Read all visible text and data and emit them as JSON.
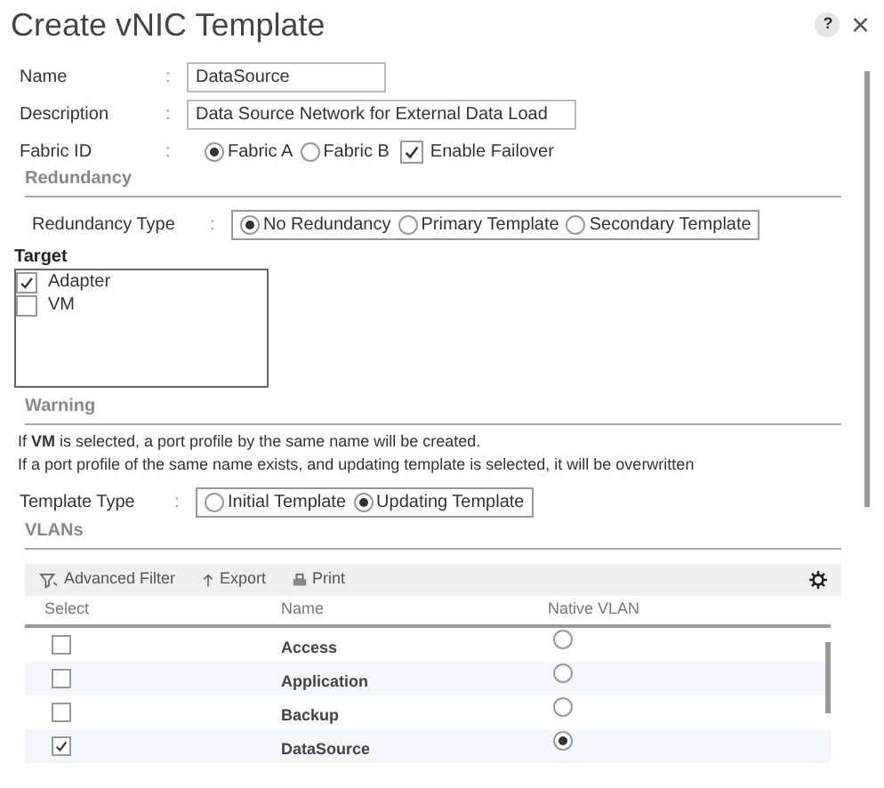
{
  "dialog": {
    "title": "Create vNIC Template",
    "help": "?",
    "close": "×"
  },
  "name": {
    "label": "Name",
    "separator": ":",
    "value": "DataSource"
  },
  "description": {
    "label": "Description",
    "separator": ":",
    "value": "Data Source Network for External Data Load"
  },
  "fabric_id": {
    "label": "Fabric ID",
    "separator": ":",
    "options": [
      {
        "label": "Fabric A",
        "selected": true
      },
      {
        "label": "Fabric B",
        "selected": false
      }
    ],
    "failover": {
      "label": "Enable Failover",
      "checked": true
    }
  },
  "redundancy": {
    "heading": "Redundancy",
    "label": "Redundancy Type",
    "separator": ":",
    "options": [
      {
        "label": "No Redundancy",
        "selected": true
      },
      {
        "label": "Primary Template",
        "selected": false
      },
      {
        "label": "Secondary Template",
        "selected": false
      }
    ]
  },
  "target": {
    "label": "Target",
    "items": [
      {
        "label": "Adapter",
        "checked": true
      },
      {
        "label": "VM",
        "checked": false
      }
    ]
  },
  "warning": {
    "heading": "Warning",
    "lines": [
      "If **VM** is selected, a port profile by the same name will be created.",
      "If a port profile of the same name exists, and updating template is selected, it will be overwritten"
    ]
  },
  "template_type": {
    "label": "Template Type",
    "separator": ":",
    "options": [
      {
        "label": "Initial Template",
        "selected": false
      },
      {
        "label": "Updating Template",
        "selected": true
      }
    ]
  },
  "vlans": {
    "heading": "VLANs",
    "toolbar": [
      "Advanced Filter",
      "Export",
      "Print"
    ],
    "columns": [
      "Select",
      "Name",
      "Native VLAN"
    ],
    "rows": [
      {
        "name": "Access",
        "checked": false,
        "native": false
      },
      {
        "name": "Application",
        "checked": false,
        "native": false
      },
      {
        "name": "Backup",
        "checked": false,
        "native": false
      },
      {
        "name": "DataSource",
        "checked": true,
        "native": true
      }
    ]
  }
}
